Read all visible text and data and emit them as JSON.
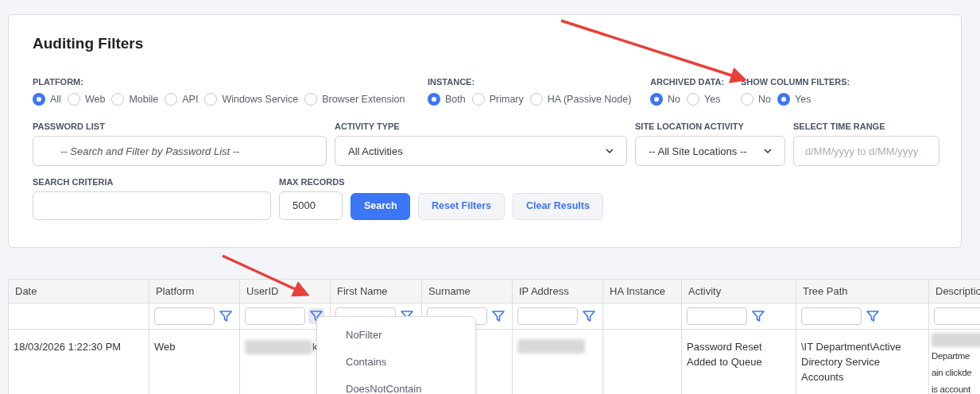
{
  "title": "Auditing Filters",
  "radio_groups": [
    {
      "label": "PLATFORM:",
      "options": [
        {
          "label": "All",
          "selected": true
        },
        {
          "label": "Web",
          "selected": false
        },
        {
          "label": "Mobile",
          "selected": false
        },
        {
          "label": "API",
          "selected": false
        },
        {
          "label": "Windows Service",
          "selected": false
        },
        {
          "label": "Browser Extension",
          "selected": false
        }
      ]
    },
    {
      "label": "INSTANCE:",
      "options": [
        {
          "label": "Both",
          "selected": true
        },
        {
          "label": "Primary",
          "selected": false
        },
        {
          "label": "HA (Passive Node)",
          "selected": false
        }
      ]
    },
    {
      "label": "ARCHIVED DATA:",
      "options": [
        {
          "label": "No",
          "selected": true
        },
        {
          "label": "Yes",
          "selected": false
        }
      ]
    },
    {
      "label": "SHOW COLUMN FILTERS:",
      "options": [
        {
          "label": "No",
          "selected": false
        },
        {
          "label": "Yes",
          "selected": true
        }
      ]
    }
  ],
  "fields": [
    {
      "kind": "text",
      "label": "PASSWORD LIST",
      "placeholder": "-- Search and Filter by Password List --"
    },
    {
      "kind": "select",
      "label": "ACTIVITY TYPE",
      "value": "All Activities"
    },
    {
      "kind": "select",
      "label": "SITE LOCATION ACTIVITY",
      "value": "-- All Site Locations --"
    },
    {
      "kind": "text",
      "label": "SELECT TIME RANGE",
      "placeholder": "d/MM/yyyy to d/MM/yyyy"
    }
  ],
  "search_criteria": {
    "label": "SEARCH CRITERIA"
  },
  "max_records": {
    "label": "MAX RECORDS",
    "value": "5000"
  },
  "buttons": [
    {
      "label": "Search",
      "kind": "primary"
    },
    {
      "label": "Reset Filters",
      "kind": "secondary"
    },
    {
      "label": "Clear Results",
      "kind": "secondary"
    }
  ],
  "table": {
    "columns": [
      {
        "header": "Date",
        "filter": false
      },
      {
        "header": "Platform",
        "filter": true,
        "open": false
      },
      {
        "header": "UserID",
        "filter": true,
        "open": true
      },
      {
        "header": "First Name",
        "filter": true,
        "open": false
      },
      {
        "header": "Surname",
        "filter": true,
        "open": false
      },
      {
        "header": "IP Address",
        "filter": true,
        "open": false
      },
      {
        "header": "HA Instance",
        "filter": false
      },
      {
        "header": "Activity",
        "filter": true,
        "open": false
      },
      {
        "header": "Tree Path",
        "filter": true,
        "open": false
      },
      {
        "header": "Descriptio",
        "filter": true
      }
    ],
    "rows": [
      [
        {
          "text": "18/03/2026 1:22:30 PM"
        },
        {
          "text": "Web"
        },
        {
          "kind": "redacted",
          "text": "k"
        },
        {},
        {},
        {
          "kind": "redacted"
        },
        {},
        {
          "text": "Password Reset Added to Queue"
        },
        {
          "text": "\\IT Department\\Active Directory Service Accounts"
        },
        {
          "kind": "redacted",
          "lines": [
            "Departme",
            "ain clickde",
            "is account"
          ]
        }
      ]
    ]
  },
  "filter_menu": {
    "items": [
      "NoFilter",
      "Contains",
      "DoesNotContain"
    ]
  }
}
